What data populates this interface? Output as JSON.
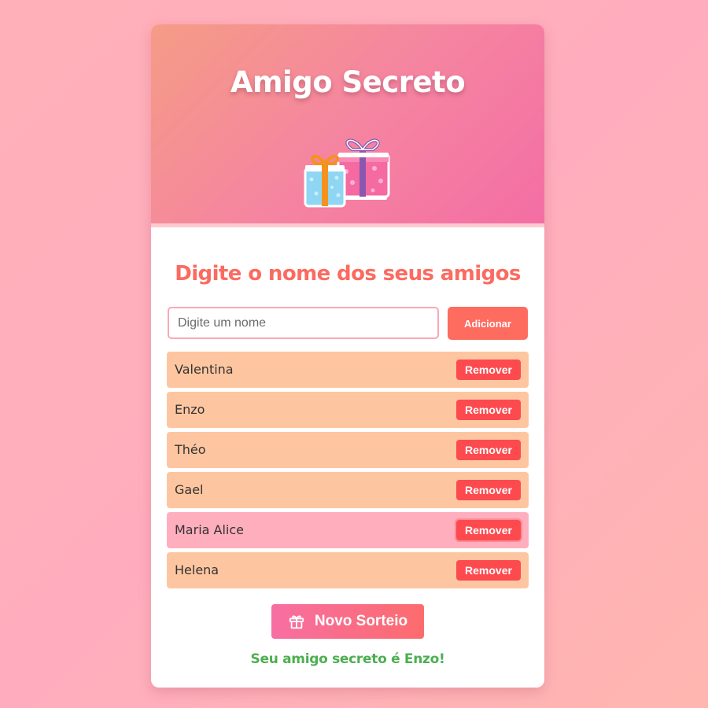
{
  "header": {
    "title": "Amigo Secreto",
    "illustration": "gift-boxes-icon"
  },
  "form": {
    "heading": "Digite o nome dos seus amigos",
    "input_placeholder": "Digite um nome",
    "input_value": "",
    "add_label": "Adicionar"
  },
  "friends": [
    {
      "name": "Valentina",
      "remove_label": "Remover"
    },
    {
      "name": "Enzo",
      "remove_label": "Remover"
    },
    {
      "name": "Théo",
      "remove_label": "Remover"
    },
    {
      "name": "Gael",
      "remove_label": "Remover"
    },
    {
      "name": "Maria Alice",
      "remove_label": "Remover",
      "hovered": true
    },
    {
      "name": "Helena",
      "remove_label": "Remover"
    }
  ],
  "draw": {
    "label": "Novo Sorteio",
    "icon": "gift-icon"
  },
  "result": {
    "text": "Seu amigo secreto é Enzo!"
  },
  "colors": {
    "accent": "#fe6b5f",
    "remove": "#fd4a4f",
    "item_bg": "#fec6a0",
    "item_hover_bg": "#ffaebe",
    "result": "#4caf50"
  }
}
